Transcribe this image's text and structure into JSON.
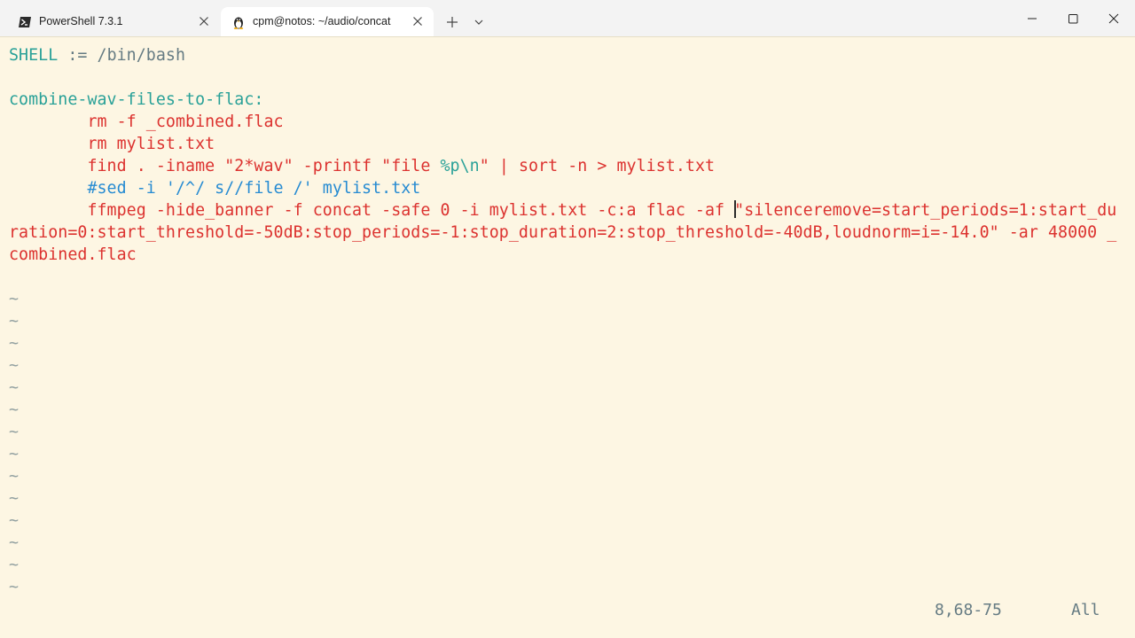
{
  "tabs": [
    {
      "title": "PowerShell 7.3.1",
      "icon": "powershell-icon",
      "active": false
    },
    {
      "title": "cpm@notos: ~/audio/concat",
      "icon": "linux-penguin-icon",
      "active": true
    }
  ],
  "titlebar": {
    "new_tab_icon": "plus-icon",
    "dropdown_icon": "chevron-down-icon",
    "window_controls": [
      "minimize-icon",
      "maximize-icon",
      "close-icon"
    ]
  },
  "editor": {
    "lines": {
      "shell_var": "SHELL",
      "shell_op": " := ",
      "shell_val": "/bin/bash",
      "target": "combine-wav-files-to-flac:",
      "cmd_rm1": "        rm -f _combined.flac",
      "cmd_rm2": "        rm mylist.txt",
      "cmd_find_a": "        find . -iname \"2*wav\" -printf \"file ",
      "cmd_find_b": "%p\\n",
      "cmd_find_c": "\" | sort -n > mylist.txt",
      "cmd_sed": "        #sed -i '/^/ s//file /' mylist.txt",
      "cmd_ffmpeg_1a": "        ffmpeg -hide_banner -f concat -safe 0 -i mylist.txt -c:a flac -af ",
      "cmd_ffmpeg_1b": "\"silenceremove=start_periods=1:start_du",
      "cmd_ffmpeg_2": "ration=0:start_threshold=-50dB:stop_periods=-1:stop_duration=2:stop_threshold=-40dB,loudnorm=i=-14.0\" -ar 48000 _",
      "cmd_ffmpeg_3": "combined.flac"
    },
    "tilde": "~",
    "tilde_count": 14
  },
  "statusline": {
    "position": "8,68-75",
    "scroll": "All"
  },
  "colors": {
    "background": "#fdf6e3",
    "red": "#dc322f",
    "teal": "#2aa198",
    "blue": "#268bd2",
    "gray": "#657b83"
  }
}
